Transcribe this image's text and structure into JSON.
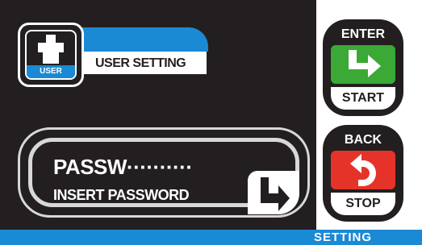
{
  "user": {
    "icon_label": "USER",
    "title": "USER SETTING",
    "icon": "person-icon"
  },
  "password": {
    "title": "PASSW··········",
    "subtitle": "INSERT PASSWORD",
    "icon": "enter-arrow-icon"
  },
  "enter_button": {
    "top_label": "ENTER",
    "bottom_label": "START",
    "color": "#3aa935",
    "icon": "enter-arrow-icon"
  },
  "back_button": {
    "top_label": "BACK",
    "bottom_label": "STOP",
    "color": "#e63329",
    "icon": "back-arrow-icon"
  },
  "footer": {
    "label": "SETTING",
    "color": "#1a8ad4"
  }
}
